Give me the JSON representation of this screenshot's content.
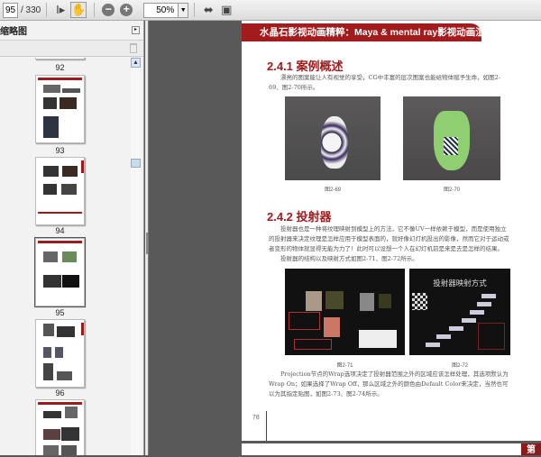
{
  "toolbar": {
    "current_page": "95",
    "total_pages": "/ 330",
    "zoom": "50%"
  },
  "sidebar": {
    "title": "缩略图",
    "thumbnails": [
      {
        "label": "92"
      },
      {
        "label": "93"
      },
      {
        "label": "94"
      },
      {
        "label": "95"
      },
      {
        "label": "96"
      }
    ]
  },
  "page": {
    "header": "水晶石影视动画精粹：Maya & mental ray影视动画渲染",
    "section1": {
      "title": "2.4.1  案例概述",
      "text": "漂亮的图案能让人有视觉的享受，CG中丰富的层次图案也能给物体赋予生命，如图2-69、图2-70所示。"
    },
    "fig69": "图2-69",
    "fig70": "图2-70",
    "section2": {
      "title": "2.4.2  投射器",
      "text1": "投射器也是一种将纹理映射到模型上的方法，它不像UV一样依赖于模型，而是使用独立的投射器来决定纹理是怎样应用于模型表面的，就好像幻灯机投出的影像，然而它对于运动或者变形的物体就显得无能为力了！此时可以设想一个人在幻灯机前是来是去是怎样的结果。",
      "text2": "投射器的结构以及映射方式如图2-71、图2-72所示。"
    },
    "fig71": "图2-71",
    "fig72": "图2-72",
    "fig72_title": "投射器映射方式",
    "text3": "Projection节点的Wrap选项决定了投射器范围之外的区域应该怎样处理，其选项默认为Wrap On；如果选择了Wrap Off，那么区域之外的颜色由Default Color来决定，当然也可以为其指定贴图，如图2-73、图2-74所示。",
    "page_number": "78",
    "next_page_tab": "第"
  }
}
